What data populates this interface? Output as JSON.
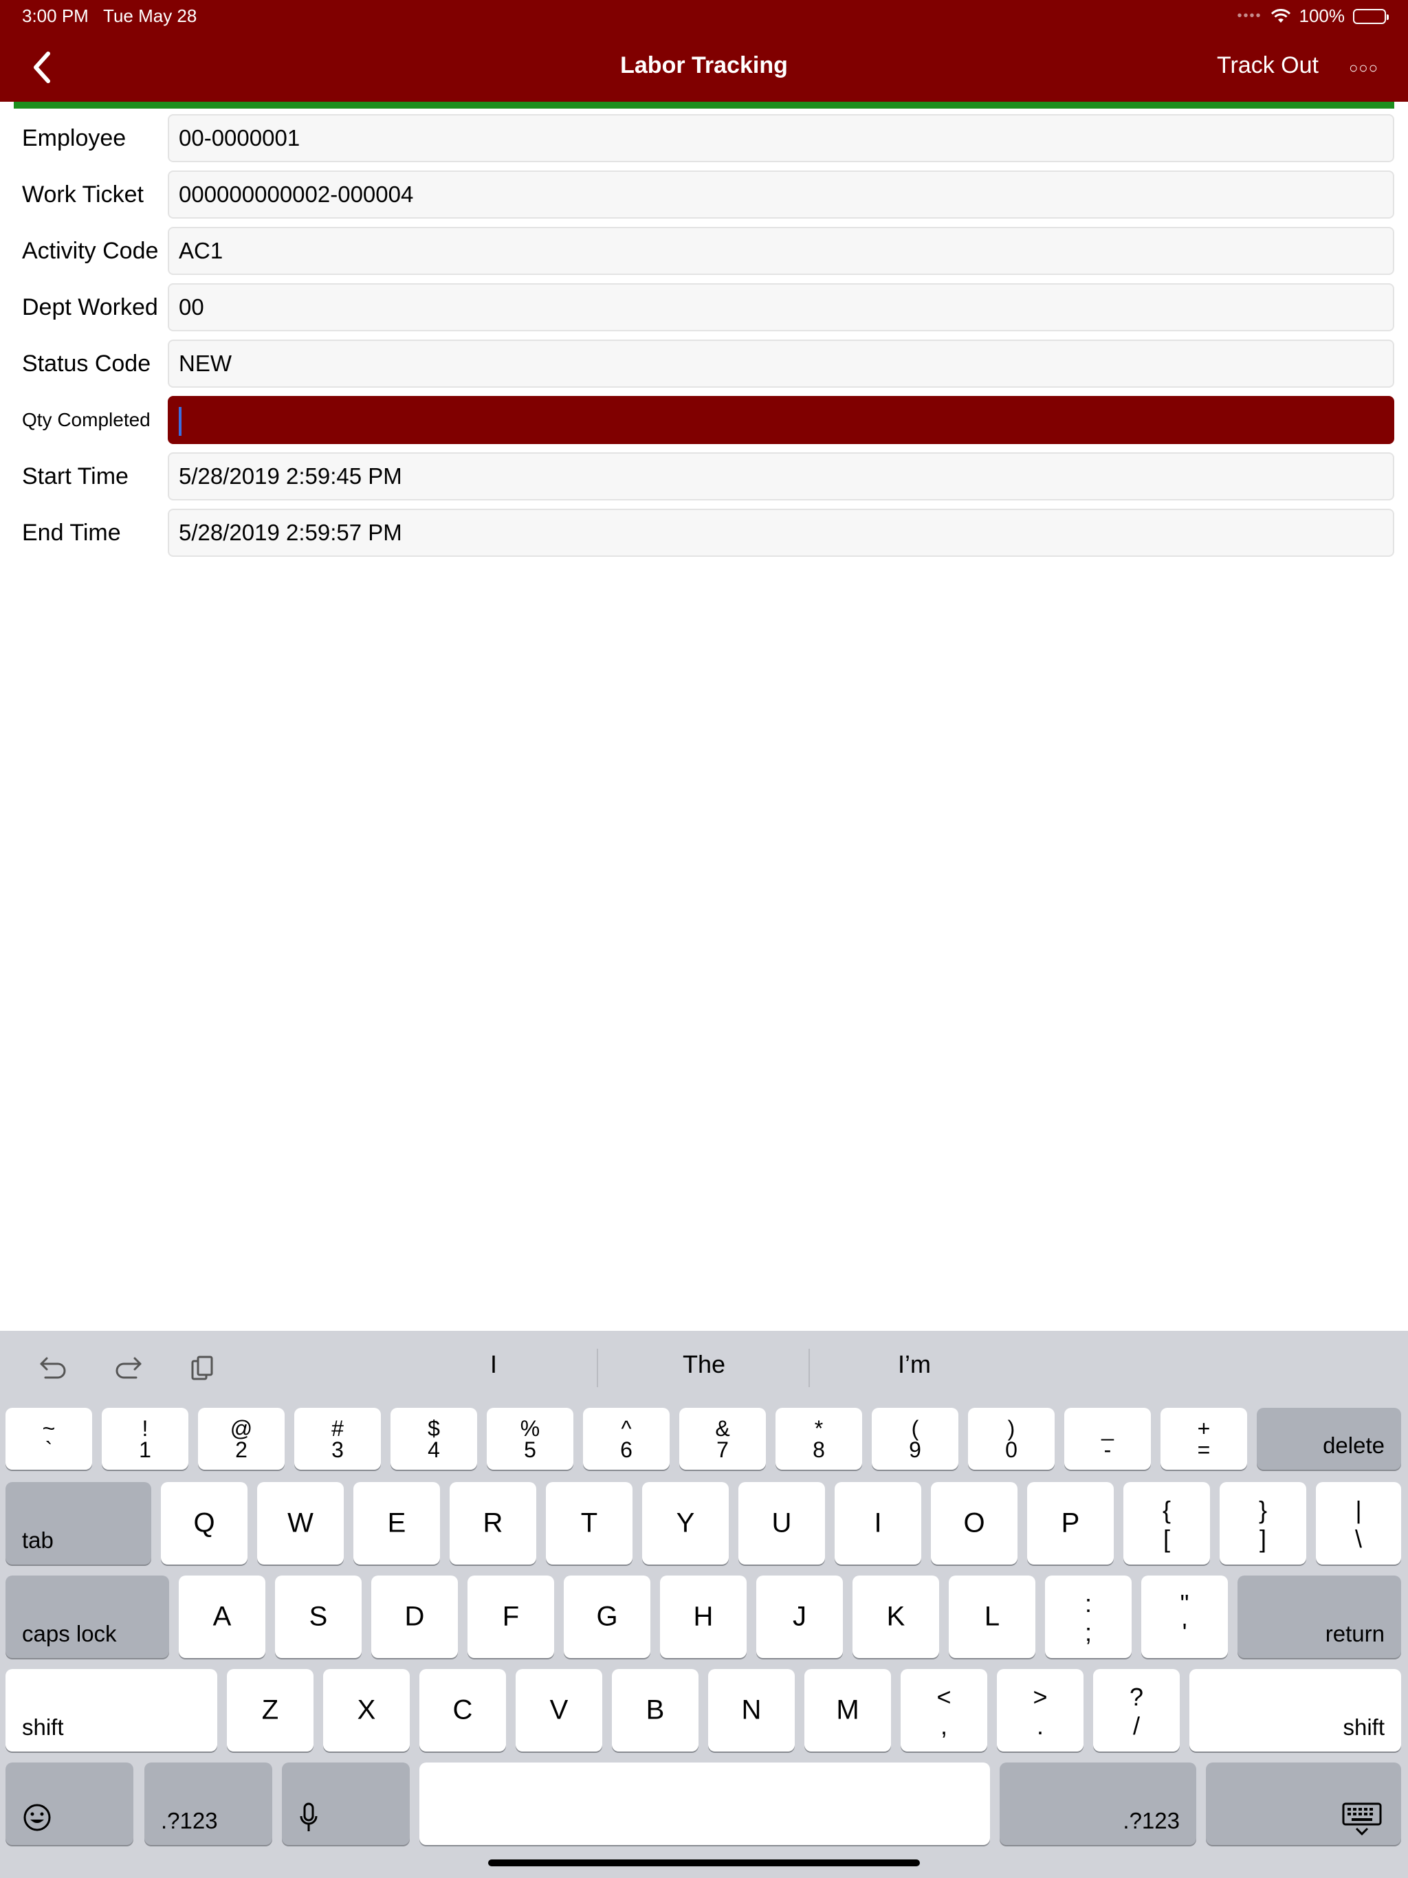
{
  "status_bar": {
    "time": "3:00 PM",
    "date": "Tue May 28",
    "battery": "100%"
  },
  "nav": {
    "title": "Labor Tracking",
    "track_out": "Track Out"
  },
  "form": {
    "fields": [
      {
        "label": "Employee",
        "value": "00-0000001"
      },
      {
        "label": "Work Ticket",
        "value": "000000000002-000004"
      },
      {
        "label": "Activity Code",
        "value": "AC1"
      },
      {
        "label": "Dept Worked",
        "value": "00"
      },
      {
        "label": "Status Code",
        "value": "NEW"
      },
      {
        "label": "Qty Completed",
        "value": ""
      },
      {
        "label": "Start Time",
        "value": "5/28/2019 2:59:45 PM"
      },
      {
        "label": "End Time",
        "value": "5/28/2019 2:59:57 PM"
      }
    ]
  },
  "keyboard": {
    "suggestions": [
      "I",
      "The",
      "I’m"
    ],
    "row1": [
      {
        "top": "~",
        "bot": "`"
      },
      {
        "top": "!",
        "bot": "1"
      },
      {
        "top": "@",
        "bot": "2"
      },
      {
        "top": "#",
        "bot": "3"
      },
      {
        "top": "$",
        "bot": "4"
      },
      {
        "top": "%",
        "bot": "5"
      },
      {
        "top": "^",
        "bot": "6"
      },
      {
        "top": "&",
        "bot": "7"
      },
      {
        "top": "*",
        "bot": "8"
      },
      {
        "top": "(",
        "bot": "9"
      },
      {
        "top": ")",
        "bot": "0"
      },
      {
        "top": "_",
        "bot": "-"
      },
      {
        "top": "+",
        "bot": "="
      }
    ],
    "row2_letters": [
      "Q",
      "W",
      "E",
      "R",
      "T",
      "Y",
      "U",
      "I",
      "O",
      "P"
    ],
    "row2_symbols": [
      {
        "top": "{",
        "bot": "["
      },
      {
        "top": "}",
        "bot": "]"
      },
      {
        "top": "|",
        "bot": "\\"
      }
    ],
    "row3_letters": [
      "A",
      "S",
      "D",
      "F",
      "G",
      "H",
      "J",
      "K",
      "L"
    ],
    "row3_symbols": [
      {
        "top": ":",
        "bot": ";"
      },
      {
        "top": "\"",
        "bot": "'"
      }
    ],
    "row4_letters": [
      "Z",
      "X",
      "C",
      "V",
      "B",
      "N",
      "M"
    ],
    "row4_symbols": [
      {
        "top": "<",
        "bot": ","
      },
      {
        "top": ">",
        "bot": "."
      },
      {
        "top": "?",
        "bot": "/"
      }
    ],
    "delete": "delete",
    "tab": "tab",
    "caps_lock": "caps lock",
    "return": "return",
    "shift": "shift",
    "numbers_left": ".?123",
    "numbers_right": ".?123"
  }
}
